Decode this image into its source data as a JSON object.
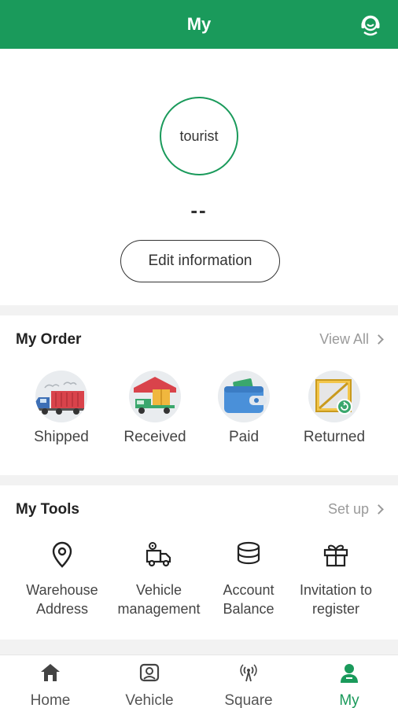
{
  "header": {
    "title": "My",
    "support_icon": "headset-icon"
  },
  "profile": {
    "avatar_text": "tourist",
    "name": "--",
    "edit_label": "Edit information"
  },
  "orders": {
    "title": "My Order",
    "link_label": "View All",
    "items": [
      {
        "label": "Shipped",
        "icon": "truck-icon"
      },
      {
        "label": "Received",
        "icon": "received-truck-icon"
      },
      {
        "label": "Paid",
        "icon": "wallet-icon"
      },
      {
        "label": "Returned",
        "icon": "return-box-icon"
      }
    ]
  },
  "tools": {
    "title": "My Tools",
    "link_label": "Set up",
    "items": [
      {
        "label_line1": "Warehouse",
        "label_line2": "Address",
        "icon": "location-pin-icon"
      },
      {
        "label_line1": "Vehicle",
        "label_line2": "management",
        "icon": "vehicle-gear-icon"
      },
      {
        "label_line1": "Account",
        "label_line2": "Balance",
        "icon": "coins-icon"
      },
      {
        "label_line1": "Invitation to",
        "label_line2": "register",
        "icon": "gift-icon"
      }
    ]
  },
  "tabbar": {
    "items": [
      {
        "label": "Home",
        "icon": "home-icon"
      },
      {
        "label": "Vehicle",
        "icon": "vehicle-icon"
      },
      {
        "label": "Square",
        "icon": "signal-icon"
      },
      {
        "label": "My",
        "icon": "user-icon",
        "active": true
      }
    ]
  },
  "colors": {
    "brand": "#1a9a5b",
    "muted": "#9a9a9a",
    "background": "#f2f2f2"
  }
}
